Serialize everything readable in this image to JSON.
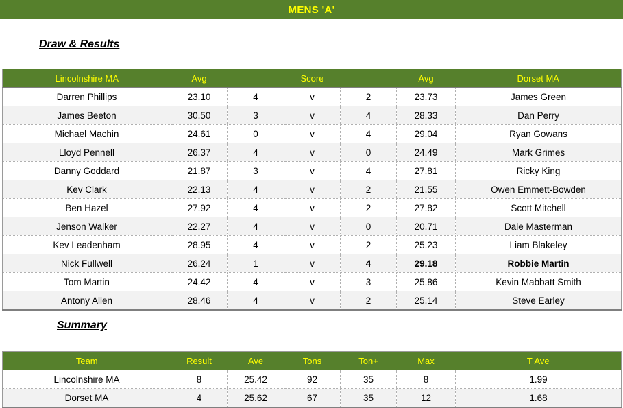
{
  "page": {
    "title": "MENS 'A'",
    "title_bg_color": "#56802C",
    "title_text_color": "#FFFF00",
    "highlight_color": "#EE0000"
  },
  "sections": {
    "draw_results_heading": "Draw & Results",
    "summary_heading": "Summary"
  },
  "draw_results": {
    "headers": [
      "Lincolnshire MA",
      "Avg",
      "",
      "Score",
      "",
      "Avg",
      "Dorset MA"
    ],
    "header_home_team": "Lincolnshire MA",
    "header_home_avg": "Avg",
    "header_score": "Score",
    "header_away_avg": "Avg",
    "header_away_team": "Dorset MA",
    "rows": [
      {
        "home": "Darren Phillips",
        "home_avg": "23.10",
        "home_score": "4",
        "v": "v",
        "away_score": "2",
        "away_avg": "23.73",
        "away": "James Green",
        "highlight": false
      },
      {
        "home": "James Beeton",
        "home_avg": "30.50",
        "home_score": "3",
        "v": "v",
        "away_score": "4",
        "away_avg": "28.33",
        "away": "Dan Perry",
        "highlight": false
      },
      {
        "home": "Michael Machin",
        "home_avg": "24.61",
        "home_score": "0",
        "v": "v",
        "away_score": "4",
        "away_avg": "29.04",
        "away": "Ryan Gowans",
        "highlight": false
      },
      {
        "home": "Lloyd Pennell",
        "home_avg": "26.37",
        "home_score": "4",
        "v": "v",
        "away_score": "0",
        "away_avg": "24.49",
        "away": "Mark Grimes",
        "highlight": false
      },
      {
        "home": "Danny Goddard",
        "home_avg": "21.87",
        "home_score": "3",
        "v": "v",
        "away_score": "4",
        "away_avg": "27.81",
        "away": "Ricky King",
        "highlight": false
      },
      {
        "home": "Kev Clark",
        "home_avg": "22.13",
        "home_score": "4",
        "v": "v",
        "away_score": "2",
        "away_avg": "21.55",
        "away": "Owen Emmett-Bowden",
        "highlight": false
      },
      {
        "home": "Ben Hazel",
        "home_avg": "27.92",
        "home_score": "4",
        "v": "v",
        "away_score": "2",
        "away_avg": "27.82",
        "away": "Scott Mitchell",
        "highlight": false
      },
      {
        "home": "Jenson Walker",
        "home_avg": "22.27",
        "home_score": "4",
        "v": "v",
        "away_score": "0",
        "away_avg": "20.71",
        "away": "Dale Masterman",
        "highlight": false
      },
      {
        "home": "Kev Leadenham",
        "home_avg": "28.95",
        "home_score": "4",
        "v": "v",
        "away_score": "2",
        "away_avg": "25.23",
        "away": "Liam Blakeley",
        "highlight": false
      },
      {
        "home": "Nick Fullwell",
        "home_avg": "26.24",
        "home_score": "1",
        "v": "v",
        "away_score": "4",
        "away_avg": "29.18",
        "away": "Robbie Martin",
        "highlight": true
      },
      {
        "home": "Tom Martin",
        "home_avg": "24.42",
        "home_score": "4",
        "v": "v",
        "away_score": "3",
        "away_avg": "25.86",
        "away": "Kevin Mabbatt Smith",
        "highlight": false
      },
      {
        "home": "Antony Allen",
        "home_avg": "28.46",
        "home_score": "4",
        "v": "v",
        "away_score": "2",
        "away_avg": "25.14",
        "away": "Steve Earley",
        "highlight": false
      }
    ]
  },
  "summary": {
    "headers": [
      "Team",
      "Result",
      "Ave",
      "Tons",
      "Ton+",
      "Max",
      "T Ave"
    ],
    "header_team": "Team",
    "header_result": "Result",
    "header_ave": "Ave",
    "header_tons": "Tons",
    "header_tonplus": "Ton+",
    "header_max": "Max",
    "header_tave": "T Ave",
    "rows": [
      {
        "team": "Lincolnshire MA",
        "result": "8",
        "ave": "25.42",
        "tons": "92",
        "tonplus": "35",
        "max": "8",
        "tave": "1.99"
      },
      {
        "team": "Dorset MA",
        "result": "4",
        "ave": "25.62",
        "tons": "67",
        "tonplus": "35",
        "max": "12",
        "tave": "1.68"
      }
    ]
  }
}
